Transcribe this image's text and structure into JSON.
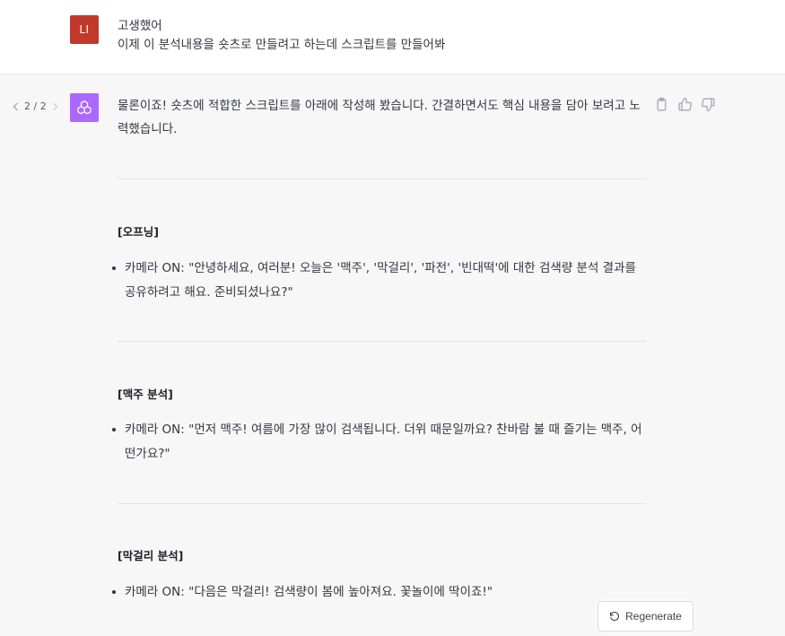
{
  "user": {
    "avatar_initials": "LI",
    "avatar_color": "#c0392b",
    "message": "고생했어\n이제 이 분석내용을 숏츠로 만들려고 하는데 스크립트를 만들어봐"
  },
  "assistant": {
    "avatar_color": "#ab68ff",
    "pager": {
      "current": "2",
      "total": "2",
      "label": "2 / 2"
    },
    "intro": "물론이죠! 숏츠에 적합한 스크립트를 아래에 작성해 봤습니다. 간결하면서도 핵심 내용을 담아 보려고 노력했습니다.",
    "sections": [
      {
        "heading": "[오프닝]",
        "bullet": "카메라 ON: \"안녕하세요, 여러분! 오늘은 '맥주', '막걸리', '파전', '빈대떡'에 대한 검색량 분석 결과를 공유하려고 해요. 준비되셨나요?\""
      },
      {
        "heading": "[맥주 분석]",
        "bullet": "카메라 ON: \"먼저 맥주! 여름에 가장 많이 검색됩니다. 더위 때문일까요? 찬바람 불 때 즐기는 맥주, 어떤가요?\""
      },
      {
        "heading": "[막걸리 분석]",
        "bullet": "카메라 ON: \"다음은 막걸리! 검색량이 봄에 높아져요. 꽃놀이에 딱이죠!\""
      }
    ],
    "actions": {
      "copy_icon": "clipboard-icon",
      "like_icon": "thumbs-up-icon",
      "dislike_icon": "thumbs-down-icon"
    }
  },
  "regenerate": {
    "label": "Regenerate",
    "icon": "refresh-icon"
  }
}
